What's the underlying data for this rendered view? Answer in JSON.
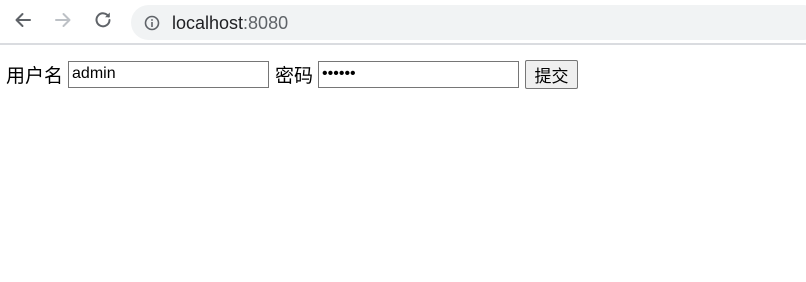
{
  "browser": {
    "url_host": "localhost",
    "url_port": ":8080",
    "icons": {
      "back": "arrow-left-icon",
      "forward": "arrow-right-icon",
      "reload": "reload-icon",
      "info": "info-icon"
    }
  },
  "form": {
    "username_label": "用户名",
    "username_value": "admin",
    "password_label": "密码",
    "password_value": "••••••",
    "submit_label": "提交"
  }
}
